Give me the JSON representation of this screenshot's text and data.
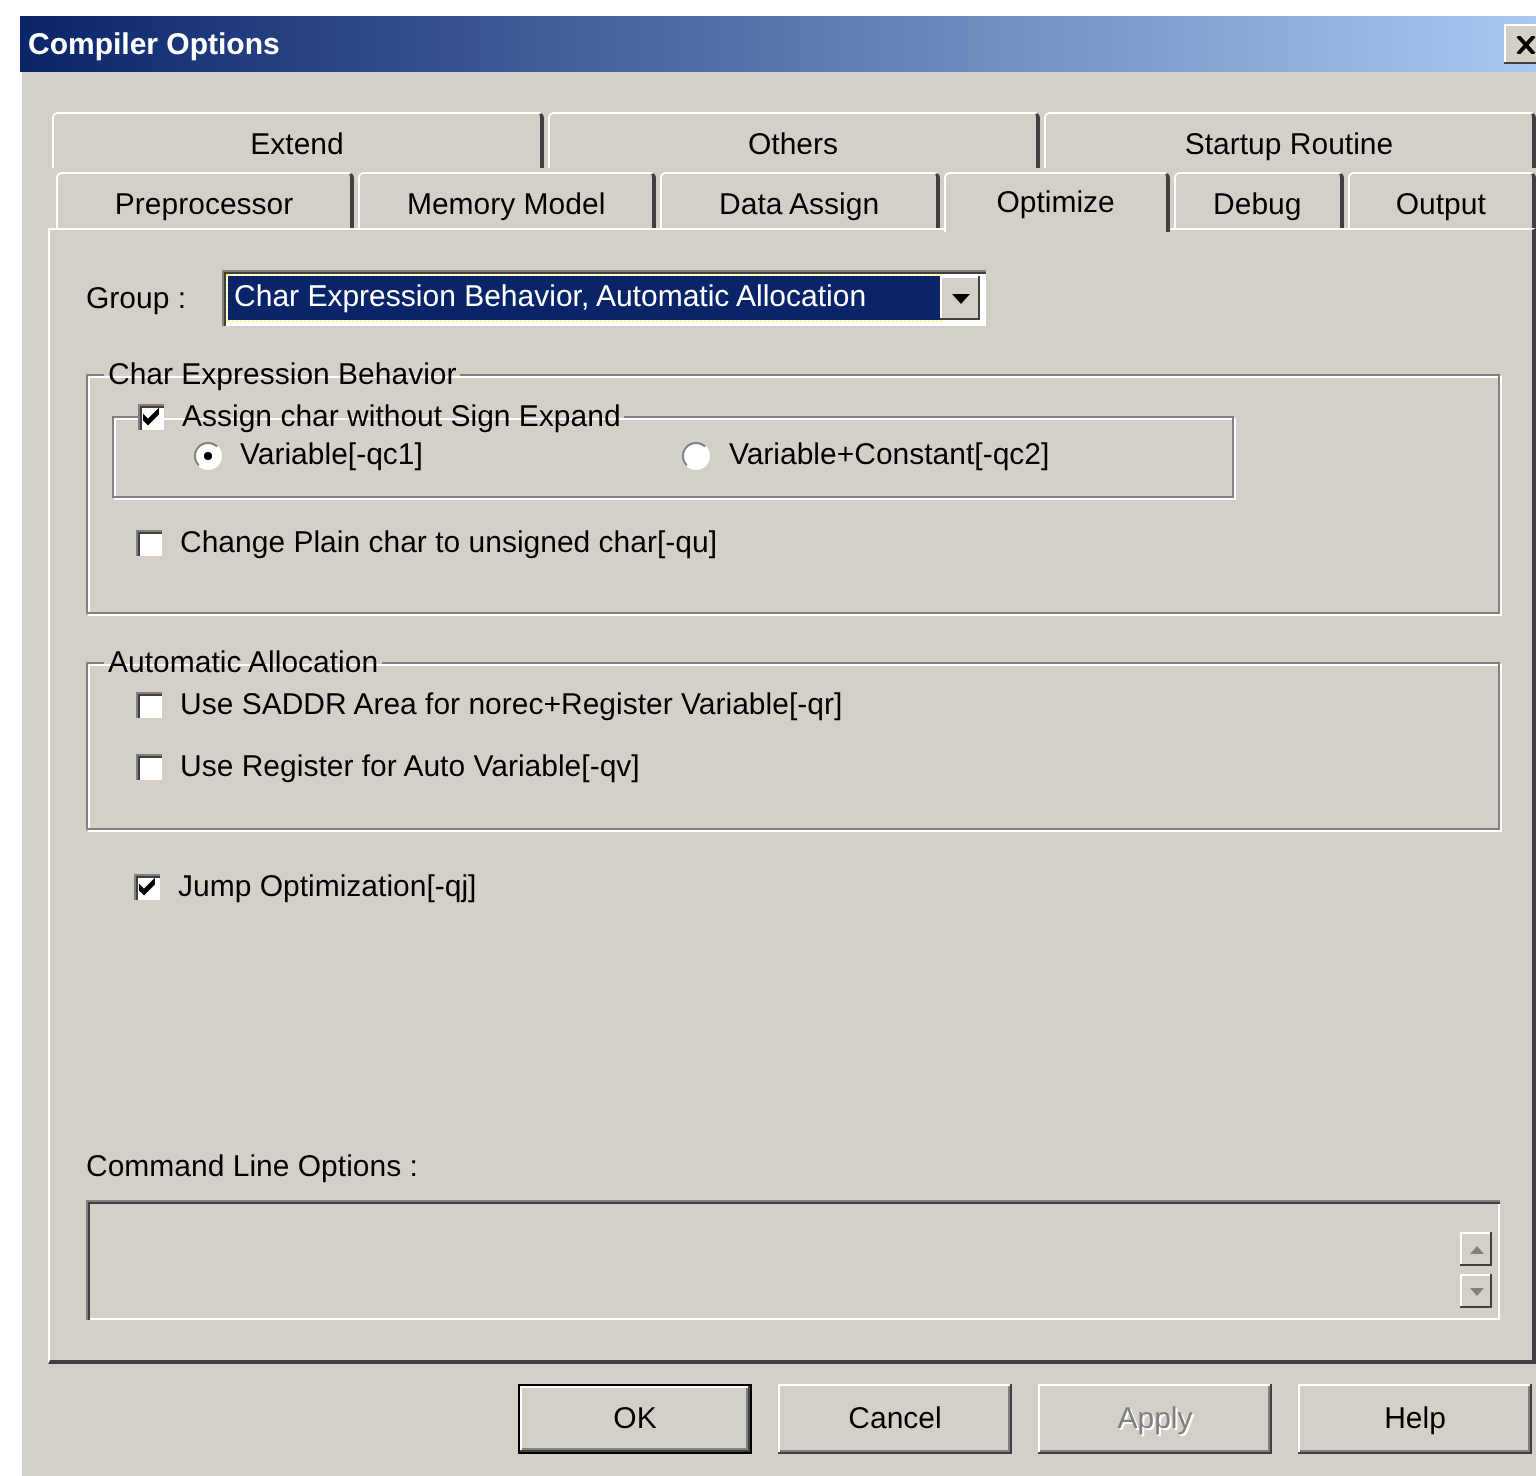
{
  "window": {
    "title": "Compiler Options"
  },
  "tabs": {
    "back_row": [
      {
        "label": "Extend",
        "selected": false
      },
      {
        "label": "Others",
        "selected": false
      },
      {
        "label": "Startup Routine",
        "selected": false
      }
    ],
    "front_row": [
      {
        "label": "Preprocessor",
        "selected": false
      },
      {
        "label": "Memory Model",
        "selected": false
      },
      {
        "label": "Data Assign",
        "selected": false
      },
      {
        "label": "Optimize",
        "selected": true
      },
      {
        "label": "Debug",
        "selected": false
      },
      {
        "label": "Output",
        "selected": false
      }
    ]
  },
  "group": {
    "label": "Group :",
    "value": "Char Expression Behavior, Automatic Allocation"
  },
  "sections": [
    {
      "title": "Char Expression Behavior",
      "items": [
        {
          "kind": "subgroup",
          "label": "Assign char without Sign Expand",
          "checked": true,
          "options": [
            {
              "label": "Variable[-qc1]",
              "selected": true
            },
            {
              "label": "Variable+Constant[-qc2]",
              "selected": false
            }
          ]
        },
        {
          "kind": "checkbox",
          "label": "Change Plain char to unsigned char[-qu]",
          "checked": false
        }
      ]
    },
    {
      "title": "Automatic Allocation",
      "items": [
        {
          "kind": "checkbox",
          "label": "Use SADDR Area for norec+Register Variable[-qr]",
          "checked": false
        },
        {
          "kind": "checkbox",
          "label": "Use Register for Auto Variable[-qv]",
          "checked": false
        }
      ]
    }
  ],
  "jump": {
    "label": "Jump Optimization[-qj]",
    "checked": true
  },
  "command_line": {
    "label": "Command Line Options :"
  },
  "buttons": [
    {
      "label": "OK",
      "default": true,
      "disabled": false
    },
    {
      "label": "Cancel",
      "default": false,
      "disabled": false
    },
    {
      "label": "Apply",
      "default": false,
      "disabled": true
    },
    {
      "label": "Help",
      "default": false,
      "disabled": false
    }
  ]
}
